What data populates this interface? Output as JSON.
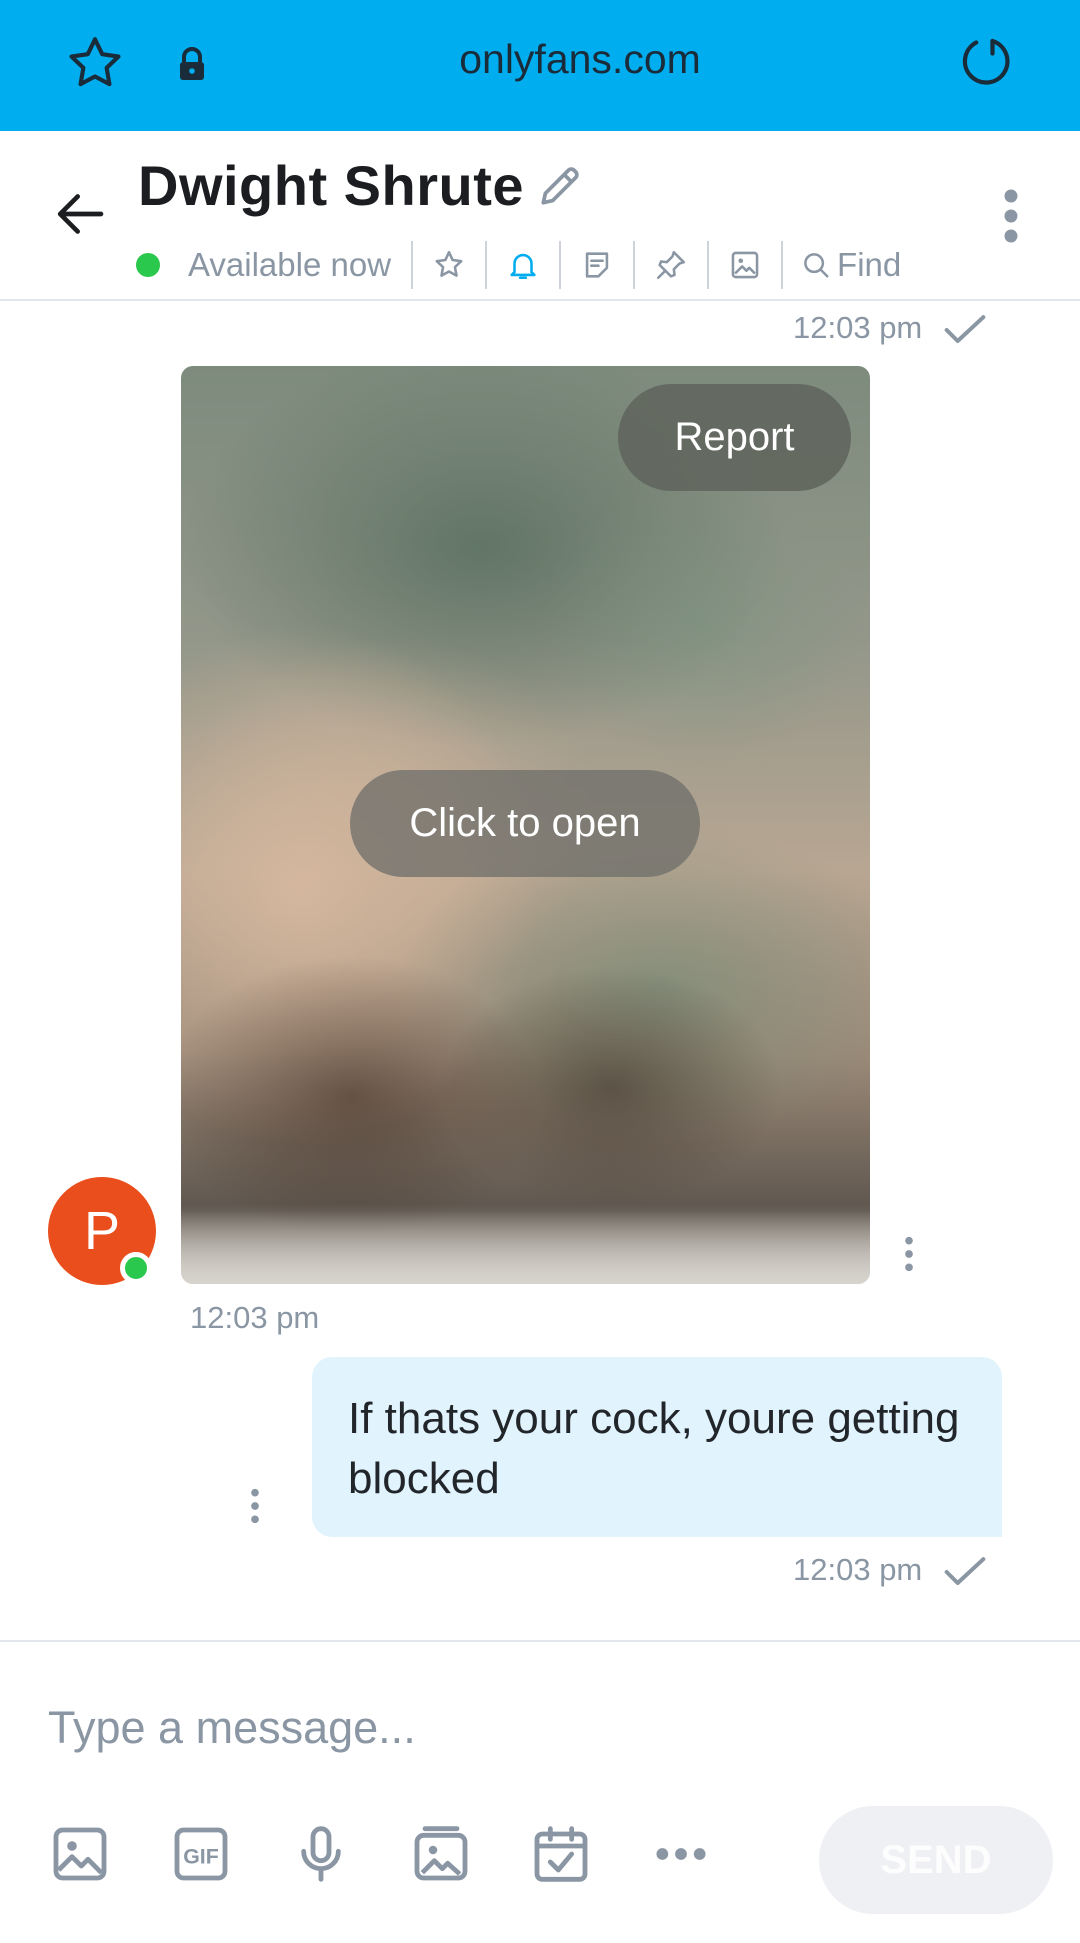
{
  "browser": {
    "url": "onlyfans.com",
    "bar_color": "#00aeef"
  },
  "header": {
    "name": "Dwight Shrute",
    "status": "Available now",
    "find_label": "Find",
    "status_color": "#2ac84c"
  },
  "messages": {
    "media_time": "12:03 pm",
    "media_time_sent": "12:03 pm",
    "report_label": "Report",
    "open_label": "Click to open",
    "avatar_initial": "P",
    "text": "If thats your cock, youre getting blocked",
    "text_time": "12:03 pm"
  },
  "composer": {
    "placeholder": "Type a message...",
    "send_label": "SEND",
    "tools": [
      "image-icon",
      "gif-icon",
      "microphone-icon",
      "vault-icon",
      "schedule-icon",
      "more-icon"
    ]
  },
  "colors": {
    "accent": "#00aeef",
    "bubble": "#e1f4fd",
    "avatar": "#ea4e1c",
    "muted": "#8a96a3"
  }
}
